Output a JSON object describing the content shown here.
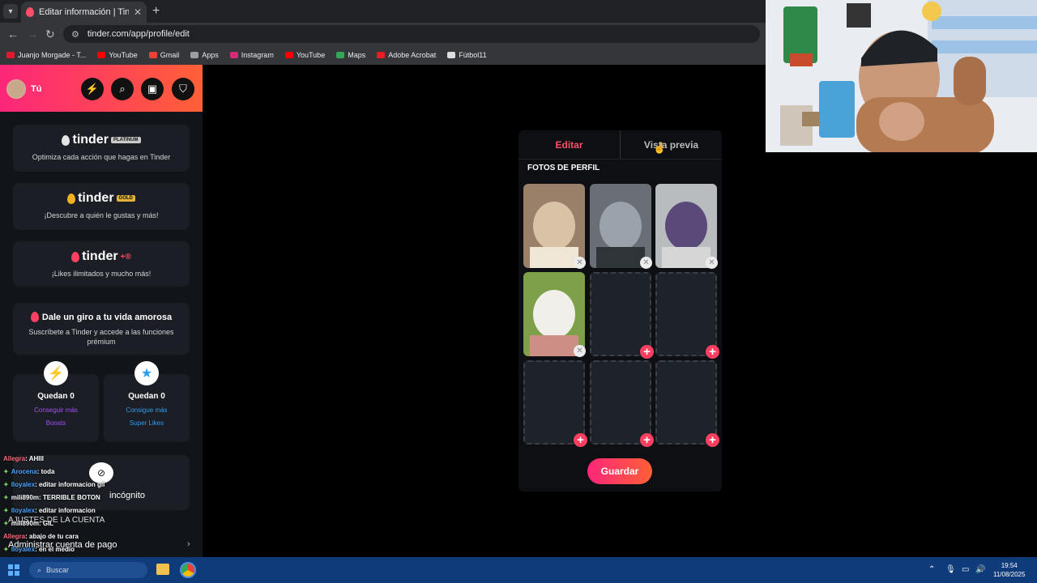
{
  "browser": {
    "tab_title": "Editar información | Tinder",
    "url": "tinder.com/app/profile/edit",
    "new_tab_icon": "plus-icon",
    "bookmarks": [
      {
        "label": "Juanjo Morgade - T...",
        "color": "#e2192c"
      },
      {
        "label": "YouTube",
        "color": "#ff0000"
      },
      {
        "label": "Gmail",
        "color": "#ea4335"
      },
      {
        "label": "Apps",
        "color": "#9aa0a6"
      },
      {
        "label": "Instagram",
        "color": "#d62976"
      },
      {
        "label": "YouTube",
        "color": "#ff0000"
      },
      {
        "label": "Maps",
        "color": "#34a853"
      },
      {
        "label": "Adobe Acrobat",
        "color": "#ec1c24"
      },
      {
        "label": "Fútbol11",
        "color": "#dddddd"
      }
    ]
  },
  "sidebar": {
    "user_label": "Tú",
    "header_buttons": [
      "boost-icon",
      "explore-icon",
      "briefcase-icon",
      "shield-icon"
    ],
    "plans": [
      {
        "brand": "tinder",
        "badge": "PLATINUM",
        "badge_color": "#c9c9c9",
        "flame": "#e5e5e5",
        "desc": "Optimiza cada acción que hagas en Tinder"
      },
      {
        "brand": "tinder",
        "badge": "GOLD",
        "badge_color": "#e4b23a",
        "flame": "#f2b01e",
        "desc": "¡Descubre a quién le gustas y más!"
      },
      {
        "brand": "tinder",
        "badge": "+®",
        "badge_color": "#fd5068",
        "flame": "#fd3f62",
        "desc": "¡Likes ilimitados y mucho más!"
      }
    ],
    "promo": {
      "title": "Dale un giro a tu vida amorosa",
      "desc": "Suscríbete a Tinder y accede a las funciones prémium"
    },
    "boosts": {
      "count": "Quedan 0",
      "link_1": "Conseguir más",
      "link_2": "Boosts",
      "color": "#a64dff"
    },
    "superlikes": {
      "count": "Quedan 0",
      "link_1": "Consigue más",
      "link_2": "Super Likes",
      "color": "#2a9df4"
    },
    "incognito_label": "incógnito",
    "account_settings": "AJUSTES DE LA CUENTA",
    "payment_account": "Administrar cuenta de pago"
  },
  "chat": [
    {
      "user": "Allegra",
      "color": "red",
      "msg": ": AHIII"
    },
    {
      "user": "Arocena",
      "color": "blue",
      "msg": ": toda"
    },
    {
      "user": "lloyalex",
      "color": "blue",
      "msg": ": editar informacion gil"
    },
    {
      "user": "mili890m",
      "color": "white",
      "msg": ": TERRIBLE BOTON"
    },
    {
      "user": "lloyalex",
      "color": "blue",
      "msg": ": editar informacion"
    },
    {
      "user": "mili890m",
      "color": "white",
      "msg": ": GIL"
    },
    {
      "user": "Allegra",
      "color": "red",
      "msg": ": abajo de tu cara"
    },
    {
      "user": "lloyalex",
      "color": "blue",
      "msg": ": en el medio"
    },
    {
      "user": "maurip13",
      "color": "gold",
      "msg": ": ahí"
    },
    {
      "user": "ol3",
      "color": "white",
      "msg": ": JASJAJAJAJAJAJA"
    }
  ],
  "editor": {
    "tab_edit": "Editar",
    "tab_preview": "Vista previa",
    "section_title": "FOTOS DE PERFIL",
    "save_label": "Guardar",
    "photos": [
      {
        "kind": "photo",
        "desc": "man-selfie-photo",
        "palette": [
          "#9a8069",
          "#d9c3a6",
          "#efe6d5"
        ]
      },
      {
        "kind": "photo",
        "desc": "car-photo",
        "palette": [
          "#6a6f75",
          "#9aa3ab",
          "#2f3439"
        ]
      },
      {
        "kind": "photo",
        "desc": "group-photo",
        "palette": [
          "#b8bcbf",
          "#5a4a7a",
          "#d6d6d6"
        ]
      },
      {
        "kind": "photo",
        "desc": "bulldog-photo",
        "palette": [
          "#7fa04a",
          "#f1efe9",
          "#cc8f86"
        ]
      },
      {
        "kind": "empty"
      },
      {
        "kind": "empty"
      },
      {
        "kind": "empty"
      },
      {
        "kind": "empty"
      },
      {
        "kind": "empty"
      }
    ]
  },
  "taskbar": {
    "search_placeholder": "Buscar",
    "time": "19:54",
    "date": "11/08/2025"
  }
}
